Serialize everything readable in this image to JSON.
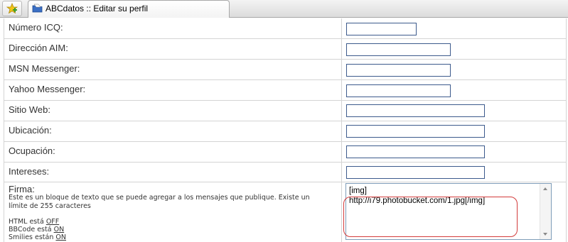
{
  "tab": {
    "title": "ABCdatos :: Editar su perfil",
    "icon": "folder-icon",
    "new_tab_icon": "add-star-icon"
  },
  "fields": [
    {
      "label": "Número ICQ:",
      "value": ""
    },
    {
      "label": "Dirección AIM:",
      "value": ""
    },
    {
      "label": "MSN Messenger:",
      "value": ""
    },
    {
      "label": "Yahoo Messenger:",
      "value": ""
    },
    {
      "label": "Sitio Web:",
      "value": ""
    },
    {
      "label": "Ubicación:",
      "value": ""
    },
    {
      "label": "Ocupación:",
      "value": ""
    },
    {
      "label": "Intereses:",
      "value": ""
    }
  ],
  "firma": {
    "label": "Firma:",
    "description": "Este es un bloque de texto que se puede agregar a los mensajes que publique. Existe un límite de 255 caracteres",
    "html_prefix": "HTML está",
    "html_value": "OFF",
    "bbcode_prefix": "BBCode está",
    "bbcode_value": "ON",
    "smilies_prefix": "Smilies están",
    "smilies_value": "ON",
    "text": "[img]\nhttp://i79.photobucket.com/1.jpg[/img]"
  },
  "colors": {
    "highlight": "#d33b3b",
    "input_border": "#3c5a8c",
    "grid": "#d4d4d4"
  }
}
